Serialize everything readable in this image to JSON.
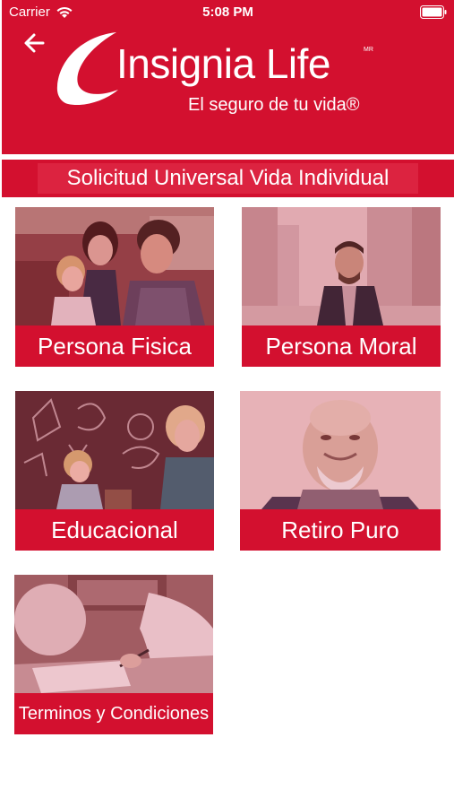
{
  "status_bar": {
    "carrier": "Carrier",
    "time": "5:08 PM"
  },
  "header": {
    "logo_name": "Insignia Life",
    "logo_mark": "MR",
    "tagline": "El seguro de tu vida®",
    "title": "Solicitud Universal Vida Individual"
  },
  "cards": [
    {
      "label": "Persona Fisica",
      "image": "family-photo"
    },
    {
      "label": "Persona Moral",
      "image": "businessman-photo"
    },
    {
      "label": "Educacional",
      "image": "child-chalkboard-photo"
    },
    {
      "label": "Retiro Puro",
      "image": "elderly-man-photo"
    },
    {
      "label": "Terminos y Condiciones",
      "image": "signing-document-photo"
    }
  ],
  "colors": {
    "brand_red": "#d3102f",
    "white": "#ffffff"
  }
}
